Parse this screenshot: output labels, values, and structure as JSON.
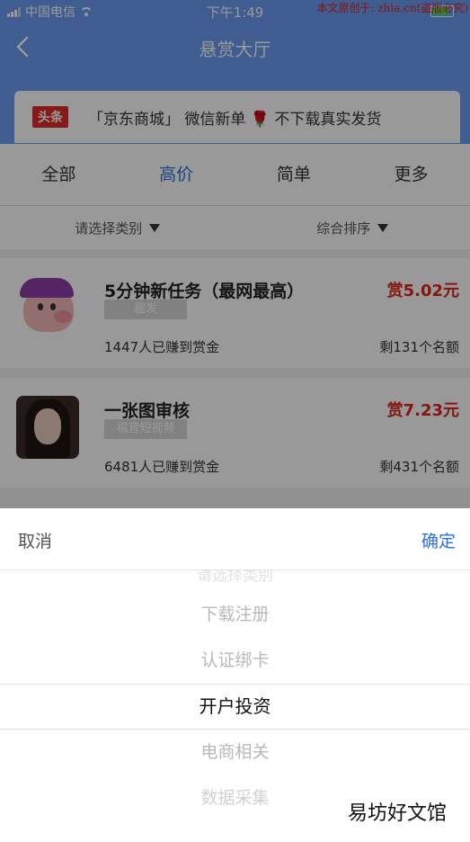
{
  "status_bar": {
    "carrier": "中国电信",
    "time": "下午1:49",
    "watermark": "本文原创于: zhia.cn(盗版必究)"
  },
  "nav": {
    "title": "悬赏大厅",
    "back_icon": "chevron-left-icon"
  },
  "banner": {
    "logo": "头条",
    "text_before": "「京东商城」 微信新单",
    "rose_icon": "🌹",
    "text_after": "不下载真实发货"
  },
  "tabs": [
    {
      "label": "全部"
    },
    {
      "label": "高价"
    },
    {
      "label": "简单"
    },
    {
      "label": "更多"
    }
  ],
  "active_tab": "高价",
  "filters": {
    "category": "请选择类别",
    "sort": "综合排序"
  },
  "tasks": [
    {
      "title": "5分钟新任务（最网最高）",
      "reward": "赏5.02元",
      "tag": "趣发",
      "earned": "1447人已赚到赏金",
      "remaining": "剩131个名额"
    },
    {
      "title": "一张图审核",
      "reward": "赏7.23元",
      "tag": "福音短视频",
      "earned": "6481人已赚到赏金",
      "remaining": "剩431个名额"
    }
  ],
  "picker": {
    "cancel": "取消",
    "confirm": "确定",
    "options": [
      "请选择类别",
      "下载注册",
      "认证绑卡",
      "开户投资",
      "电商相关",
      "数据采集"
    ],
    "selected": "开户投资"
  },
  "watermark_bottom": "易坊好文馆",
  "colors": {
    "header_blue": "#6a9cf0",
    "accent_blue": "#2d6fe0",
    "reward_red": "#e0241c"
  }
}
